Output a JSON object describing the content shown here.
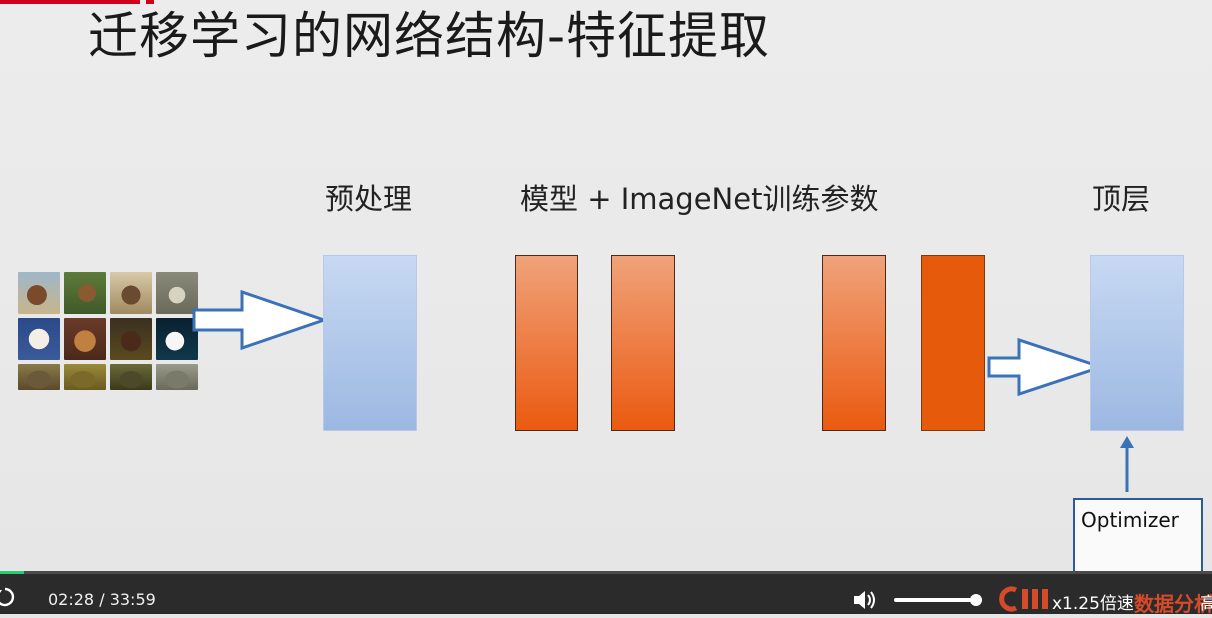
{
  "slide": {
    "title": "迁移学习的网络结构-特征提取",
    "labels": {
      "preprocess": "预处理",
      "model": "模型 + ImageNet训练参数",
      "top_layer": "顶层"
    },
    "optimizer_label": "Optimizer",
    "colors": {
      "blue_box": "#a9c3e8",
      "orange_box": "#ea5a10",
      "arrow_outline": "#3a72b8",
      "accent": "#d0021b"
    }
  },
  "player": {
    "current_time": "02:28",
    "separator": "/",
    "total_time": "33:59",
    "progress": 0.02,
    "volume_level": 0.93,
    "speed_label": "x1.25倍速",
    "brand_text": "数据分析",
    "quality_label": "高",
    "icons": {
      "replay": "replay-icon",
      "volume": "volume-icon",
      "logo": "brand-logo-icon"
    },
    "colors": {
      "progress": "#2ecc71",
      "brand": "#d44a2a"
    }
  }
}
